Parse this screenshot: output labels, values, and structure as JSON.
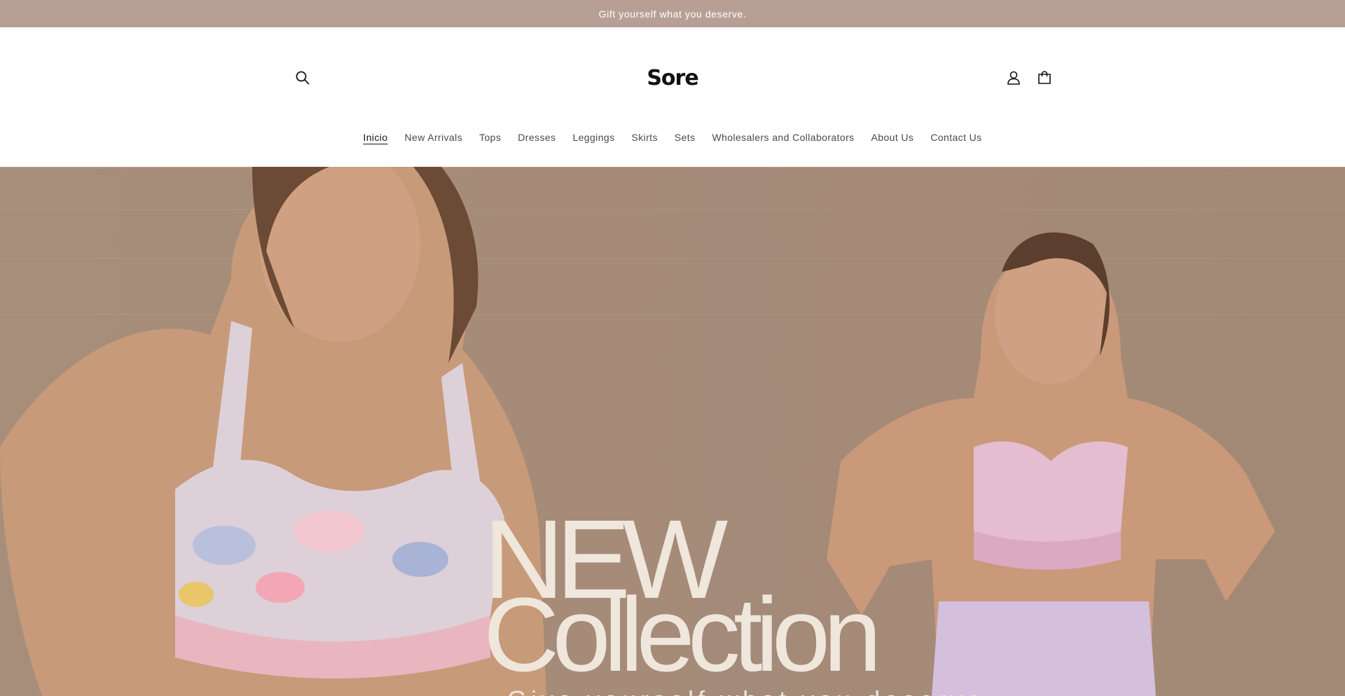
{
  "announcement": {
    "text": "Gift yourself what you deserve."
  },
  "header": {
    "logo": "Sore",
    "icons": {
      "search": "search-icon",
      "account": "account-icon",
      "cart": "cart-icon"
    }
  },
  "nav": {
    "items": [
      {
        "label": "Inicio",
        "active": true
      },
      {
        "label": "New Arrivals"
      },
      {
        "label": "Tops"
      },
      {
        "label": "Dresses"
      },
      {
        "label": "Leggings"
      },
      {
        "label": "Skirts"
      },
      {
        "label": "Sets"
      },
      {
        "label": "Wholesalers and Collaborators"
      },
      {
        "label": "About Us"
      },
      {
        "label": "Contact Us"
      }
    ]
  },
  "hero": {
    "title_line1": "NEW",
    "title_line2": "Collection",
    "subtitle": "Give yourself what you deserve",
    "colors": {
      "background": "#a58b78",
      "text": "#efe6dc",
      "announcement_bg": "#b89f96"
    }
  }
}
